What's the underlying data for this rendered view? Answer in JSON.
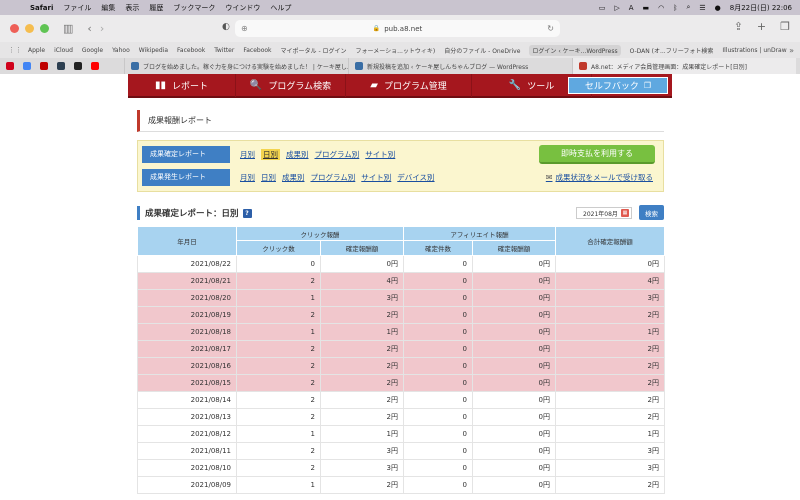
{
  "menubar": {
    "app": "Safari",
    "items": [
      "ファイル",
      "編集",
      "表示",
      "履歴",
      "ブックマーク",
      "ウインドウ",
      "ヘルプ"
    ],
    "datetime": "8月22日(日)  22:06"
  },
  "browser": {
    "url": "pub.a8.net",
    "favorites": [
      "Apple",
      "iCloud",
      "Google",
      "Yahoo",
      "Wikipedia",
      "Facebook",
      "Twitter",
      "Facebook",
      "マイポータル - ログイン",
      "フォーメーショ...ットウィキ)",
      "自分のファイル - OneDrive",
      "ログイン ‹ ケーキ...WordPress",
      "O-DAN (オ...フリーフォト検索",
      "Illustrations | unDraw"
    ],
    "tabs": [
      {
        "title": "ブログを始めました。稼ぐ力を身につける実験を始めました！ | ケーキ屋し..."
      },
      {
        "title": "新規投稿を追加 ‹ ケーキ屋しんちゃんブログ — WordPress"
      },
      {
        "title": "A8.net：メディア会員管理画面：成果確定レポート[日別]"
      }
    ]
  },
  "nav": {
    "report": "レポート",
    "program_search": "プログラム検索",
    "program_manage": "プログラム管理",
    "tools": "ツール",
    "selfback": "セルフバック"
  },
  "section": {
    "title": "成果報酬レポート"
  },
  "filters": {
    "confirmed_label": "成果確定レポート",
    "confirmed_links": [
      "月別",
      "日別",
      "成果別",
      "プログラム別",
      "サイト別"
    ],
    "confirmed_selected": "日別",
    "occurred_label": "成果発生レポート",
    "occurred_links": [
      "月別",
      "日別",
      "成果別",
      "プログラム別",
      "サイト別",
      "デバイス別"
    ],
    "instant_payment": "即時支払を利用する",
    "email_link": "成果状況をメールで受け取る"
  },
  "report": {
    "title": "成果確定レポート：日別",
    "month": "2021年08月",
    "search_button": "検索",
    "headers": {
      "date": "年月日",
      "click_group": "クリック報酬",
      "affiliate_group": "アフィリエイト報酬",
      "total": "合計確定報酬額",
      "click_count": "クリック数",
      "click_amount": "確定報酬額",
      "aff_count": "確定件数",
      "aff_amount": "確定報酬額"
    },
    "rows": [
      {
        "date": "2021/08/22",
        "clicks": "0",
        "click_reward": "0円",
        "aff_count": "0",
        "aff_reward": "0円",
        "total": "0円",
        "hl": false
      },
      {
        "date": "2021/08/21",
        "clicks": "2",
        "click_reward": "4円",
        "aff_count": "0",
        "aff_reward": "0円",
        "total": "4円",
        "hl": true
      },
      {
        "date": "2021/08/20",
        "clicks": "1",
        "click_reward": "3円",
        "aff_count": "0",
        "aff_reward": "0円",
        "total": "3円",
        "hl": true
      },
      {
        "date": "2021/08/19",
        "clicks": "2",
        "click_reward": "2円",
        "aff_count": "0",
        "aff_reward": "0円",
        "total": "2円",
        "hl": true
      },
      {
        "date": "2021/08/18",
        "clicks": "1",
        "click_reward": "1円",
        "aff_count": "0",
        "aff_reward": "0円",
        "total": "1円",
        "hl": true
      },
      {
        "date": "2021/08/17",
        "clicks": "2",
        "click_reward": "2円",
        "aff_count": "0",
        "aff_reward": "0円",
        "total": "2円",
        "hl": true
      },
      {
        "date": "2021/08/16",
        "clicks": "2",
        "click_reward": "2円",
        "aff_count": "0",
        "aff_reward": "0円",
        "total": "2円",
        "hl": true
      },
      {
        "date": "2021/08/15",
        "clicks": "2",
        "click_reward": "2円",
        "aff_count": "0",
        "aff_reward": "0円",
        "total": "2円",
        "hl": true
      },
      {
        "date": "2021/08/14",
        "clicks": "2",
        "click_reward": "2円",
        "aff_count": "0",
        "aff_reward": "0円",
        "total": "2円",
        "hl": false
      },
      {
        "date": "2021/08/13",
        "clicks": "2",
        "click_reward": "2円",
        "aff_count": "0",
        "aff_reward": "0円",
        "total": "2円",
        "hl": false
      },
      {
        "date": "2021/08/12",
        "clicks": "1",
        "click_reward": "1円",
        "aff_count": "0",
        "aff_reward": "0円",
        "total": "1円",
        "hl": false
      },
      {
        "date": "2021/08/11",
        "clicks": "2",
        "click_reward": "3円",
        "aff_count": "0",
        "aff_reward": "0円",
        "total": "3円",
        "hl": false
      },
      {
        "date": "2021/08/10",
        "clicks": "2",
        "click_reward": "3円",
        "aff_count": "0",
        "aff_reward": "0円",
        "total": "3円",
        "hl": false
      },
      {
        "date": "2021/08/09",
        "clicks": "1",
        "click_reward": "2円",
        "aff_count": "0",
        "aff_reward": "0円",
        "total": "2円",
        "hl": false
      }
    ]
  },
  "colors": {
    "nav_red": "#a5171e",
    "accent_blue": "#3f7fc4",
    "highlight_pink": "#f1c7cc",
    "filter_bg": "#fbf6cf",
    "green_button": "#78c040"
  }
}
